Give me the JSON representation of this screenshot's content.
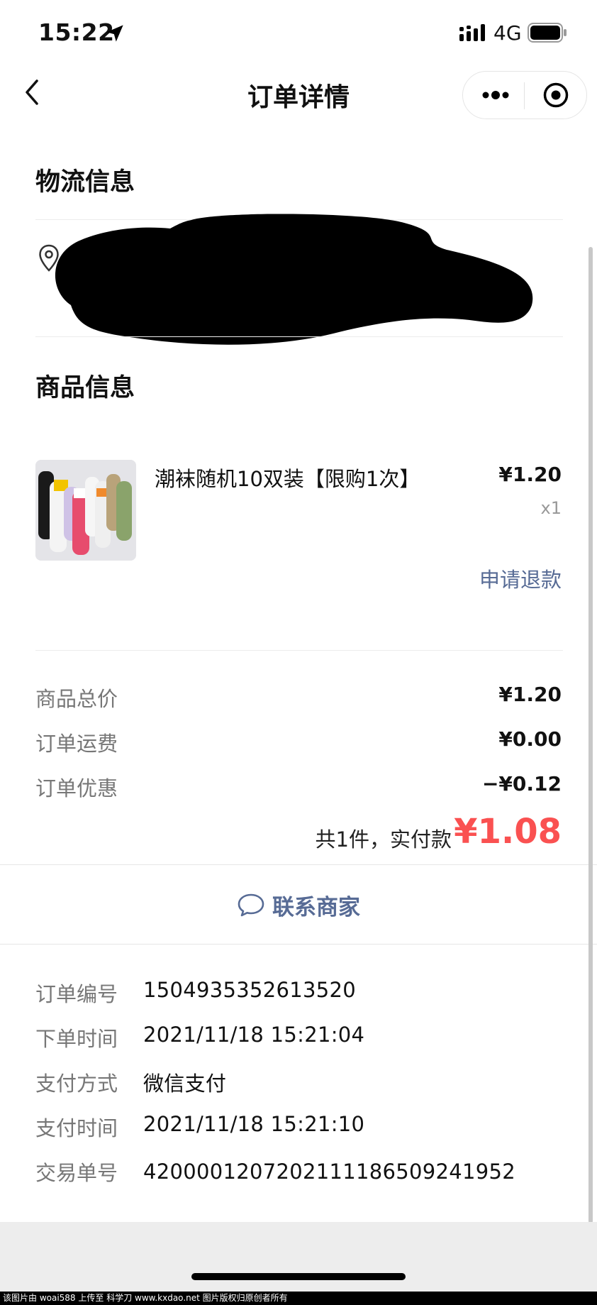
{
  "status_bar": {
    "time": "15:22",
    "network": "4G"
  },
  "nav": {
    "title": "订单详情"
  },
  "logistics": {
    "title": "物流信息"
  },
  "goods": {
    "title": "商品信息",
    "item": {
      "name": "潮袜随机10双装【限购1次】",
      "price": "¥1.20",
      "quantity": "x1",
      "refund_label": "申请退款"
    }
  },
  "summary": {
    "rows": [
      {
        "label": "商品总价",
        "value": "¥1.20"
      },
      {
        "label": "订单运费",
        "value": "¥0.00"
      },
      {
        "label": "订单优惠",
        "value": "−¥0.12"
      }
    ],
    "total_label": "共1件，实付款",
    "total_value": "¥1.08"
  },
  "contact": {
    "label": "联系商家"
  },
  "order_info": {
    "rows": [
      {
        "label": "订单编号",
        "value": "1504935352613520"
      },
      {
        "label": "下单时间",
        "value": "2021/11/18 15:21:04"
      },
      {
        "label": "支付方式",
        "value": "微信支付"
      },
      {
        "label": "支付时间",
        "value": "2021/11/18 15:21:10"
      },
      {
        "label": "交易单号",
        "value": "4200001207202111186509241952"
      }
    ]
  },
  "watermark": "该图片由 woai588 上传至 科学刀 www.kxdao.net 图片版权归原创者所有",
  "colors": {
    "accent_link": "#576b95",
    "price_red": "#fa5151",
    "label_gray": "#777777"
  }
}
